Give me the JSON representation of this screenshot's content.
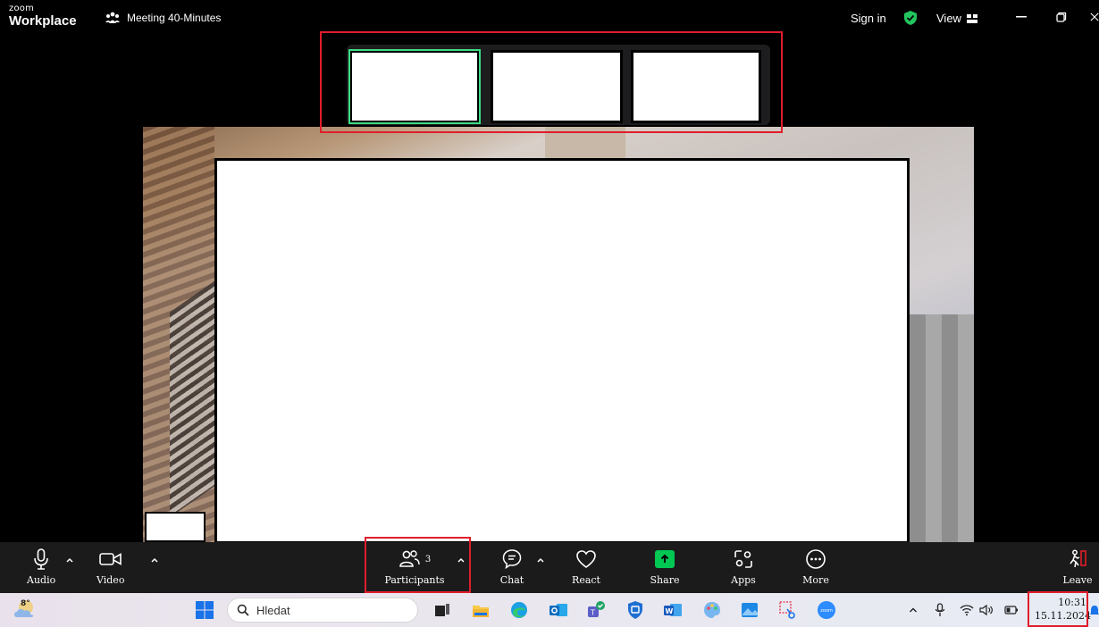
{
  "app": {
    "brand_small": "zoom",
    "brand_name": "Workplace",
    "meeting_title": "Meeting 40-Minutes",
    "sign_in": "Sign in",
    "view_label": "View"
  },
  "colors": {
    "accent_green": "#00c853",
    "active_border": "#3ddc84",
    "highlight_red": "#e01e2b",
    "shield_green": "#22c55e"
  },
  "controls": {
    "audio": "Audio",
    "video": "Video",
    "participants": "Participants",
    "participants_count": "3",
    "chat": "Chat",
    "react": "React",
    "share": "Share",
    "apps": "Apps",
    "more": "More",
    "leave": "Leave"
  },
  "taskbar": {
    "weather_temp": "8°",
    "search_placeholder": "Hledat",
    "time": "10:31",
    "date": "15.11.2024"
  }
}
